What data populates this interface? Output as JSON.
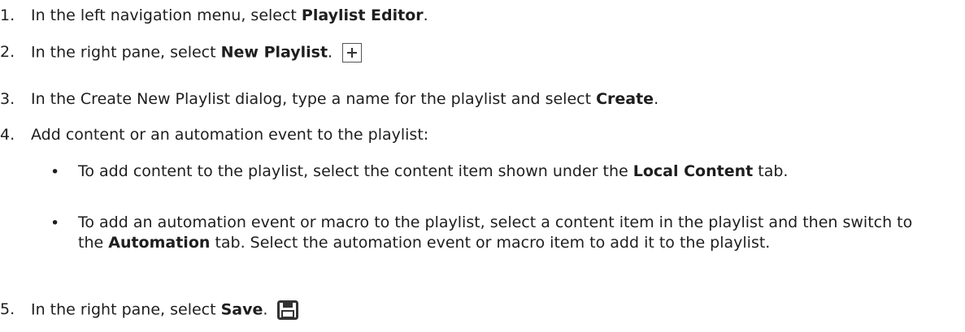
{
  "steps": [
    {
      "num": "1.",
      "pre": "In the left navigation menu, select ",
      "bold": "Playlist Editor",
      "post": "."
    },
    {
      "num": "2.",
      "pre": "In the right pane, select ",
      "bold": "New Playlist",
      "post": ".",
      "icon": "plus-icon"
    },
    {
      "num": "3.",
      "pre": "In the Create New Playlist dialog, type a name for the playlist and select ",
      "bold": "Create",
      "post": "."
    },
    {
      "num": "4.",
      "text": "Add content or an automation event to the playlist:"
    },
    {
      "num": "5.",
      "pre": "In the right pane, select ",
      "bold": "Save",
      "post": ".",
      "icon": "save-icon"
    }
  ],
  "bullets": [
    {
      "dot": "•",
      "pre": "To add content to the playlist, select the content item shown under the ",
      "bold": "Local Content",
      "post": " tab."
    },
    {
      "dot": "•",
      "pre": "To add an automation event or macro to the playlist, select a content item in the playlist and then switch to the ",
      "bold": "Automation",
      "post": " tab. Select the automation event or macro item to add it to the playlist."
    }
  ]
}
